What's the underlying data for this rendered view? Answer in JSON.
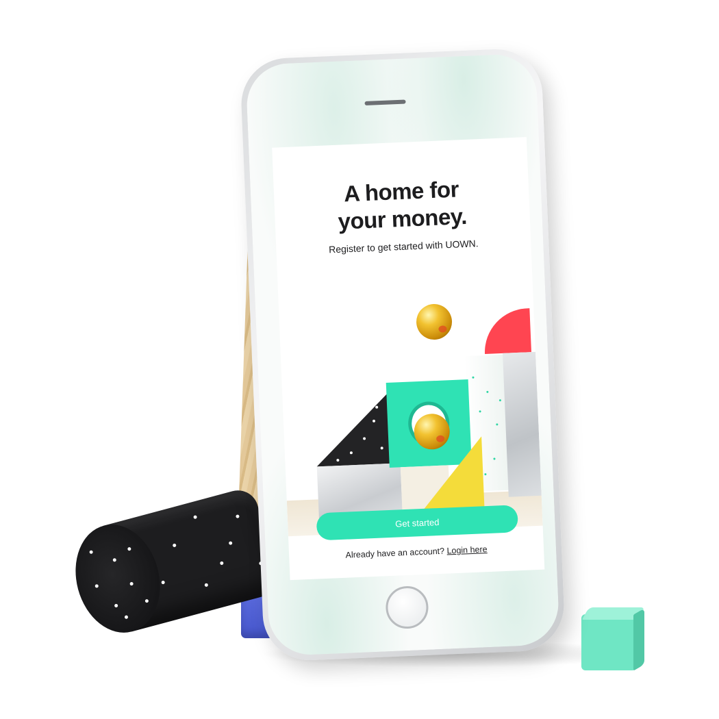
{
  "screen": {
    "headline_line1": "A home for",
    "headline_line2": "your money.",
    "subtitle": "Register to get started with UOWN.",
    "get_started_label": "Get started",
    "login_prompt": "Already have an account?",
    "login_link": "Login here"
  },
  "colors": {
    "accent": "#2fe2b4",
    "red_shape": "#ff4551",
    "yellow_shape": "#f4dc3a",
    "blue_block": "#4656cc",
    "mint_cube": "#6fe6c4"
  },
  "icons": [
    "speaker-grille-icon",
    "home-button-icon"
  ]
}
